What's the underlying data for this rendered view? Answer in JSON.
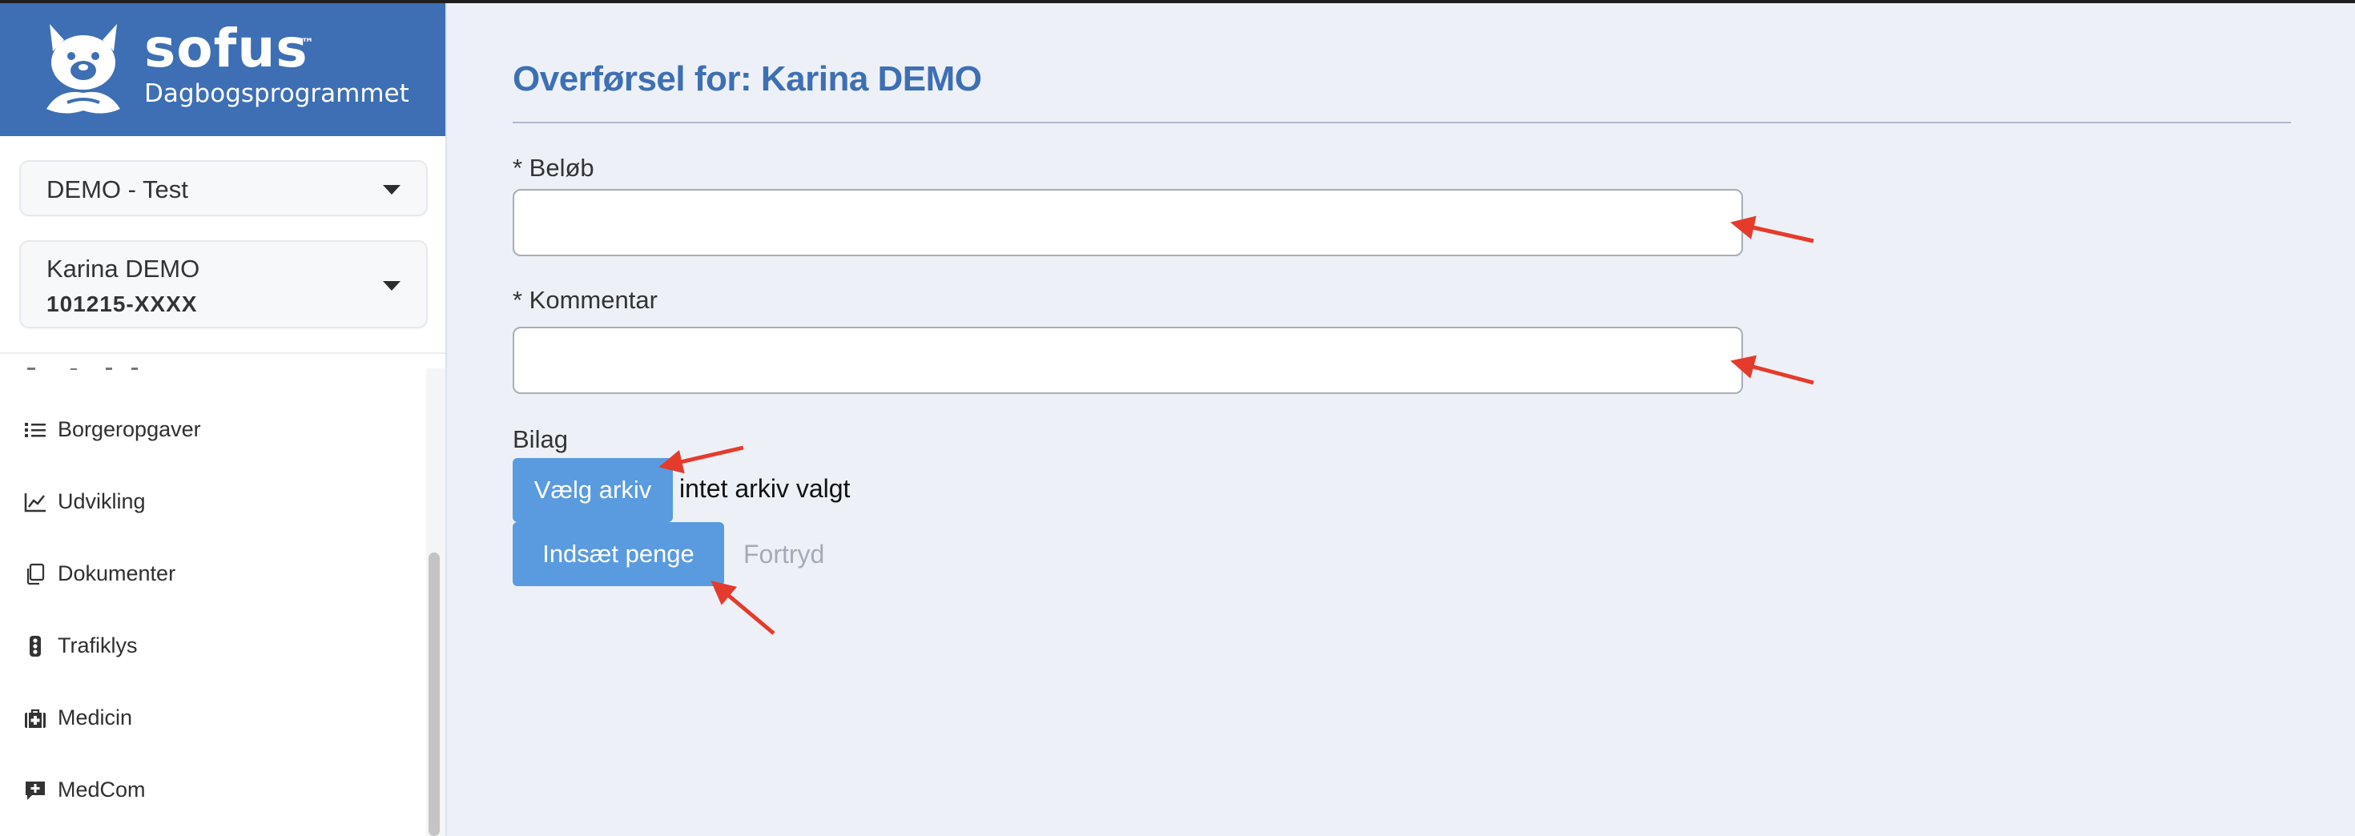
{
  "brand": {
    "name": "sofus",
    "trademark": "™",
    "subtitle": "Dagbogsprogrammet",
    "color": "#3e6fb4"
  },
  "selectors": {
    "organization": "DEMO - Test",
    "citizen_name": "Karina DEMO",
    "citizen_id": "101215-XXXX"
  },
  "nav": {
    "items": [
      {
        "label": "Borgeropgaver",
        "icon": "list-icon"
      },
      {
        "label": "Udvikling",
        "icon": "line-chart-icon"
      },
      {
        "label": "Dokumenter",
        "icon": "documents-icon"
      },
      {
        "label": "Trafiklys",
        "icon": "traffic-light-icon"
      },
      {
        "label": "Medicin",
        "icon": "medical-kit-icon"
      },
      {
        "label": "MedCom",
        "icon": "message-plus-icon"
      }
    ]
  },
  "form": {
    "title": "Overførsel for: Karina DEMO",
    "amount_label": "* Beløb",
    "amount_value": "",
    "comment_label": "* Kommentar",
    "comment_value": "",
    "attachment_label": "Bilag",
    "choose_file_label": "Vælg arkiv",
    "file_status": "intet arkiv valgt",
    "submit_label": "Indsæt penge",
    "cancel_label": "Fortryd"
  },
  "colors": {
    "accent": "#3e6fb4",
    "button": "#5a9be0",
    "annotation_arrow": "#e53b2c",
    "background": "#edf1f7"
  }
}
